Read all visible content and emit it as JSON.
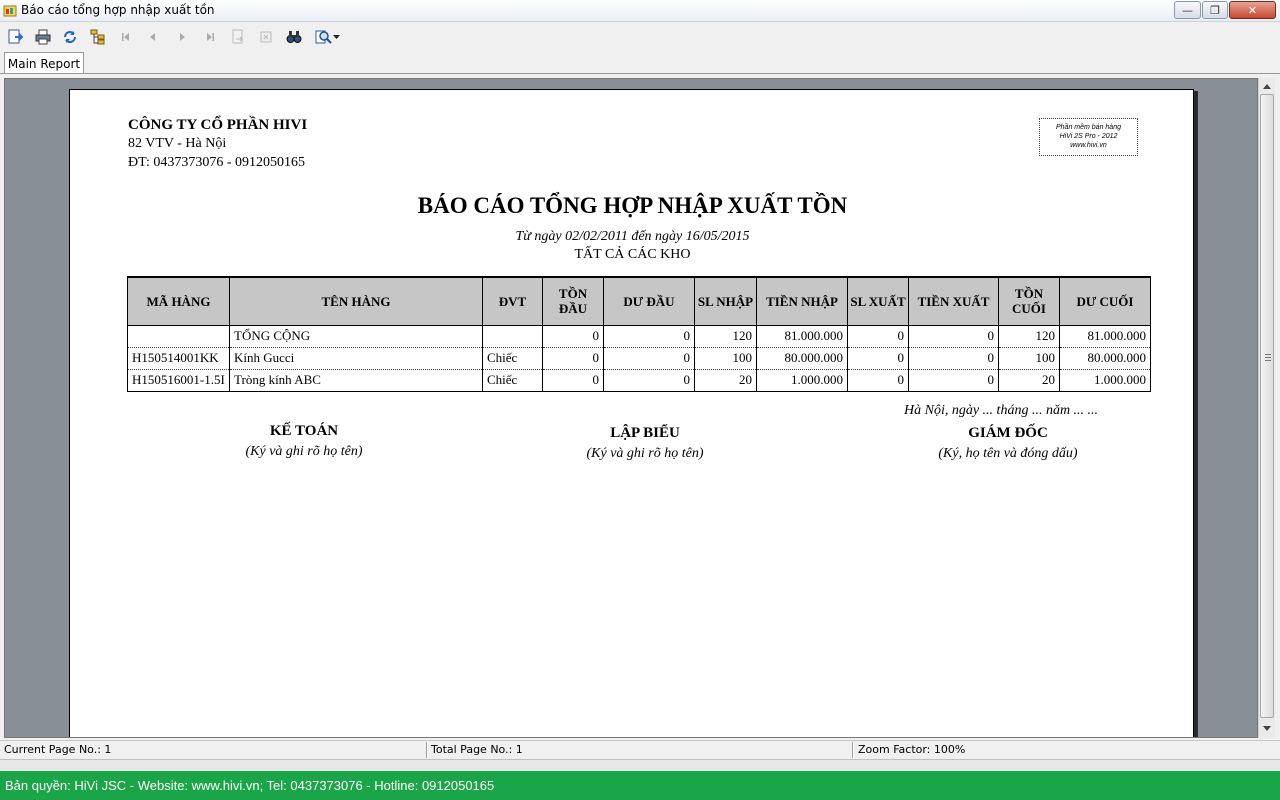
{
  "window": {
    "title": "Báo cáo tổng hợp nhập xuất tồn",
    "minimize": "—",
    "restore": "❐",
    "close": "✕"
  },
  "tab": {
    "label": "Main Report"
  },
  "report": {
    "company_name": "CÔNG TY CỔ PHẦN HIVI",
    "company_address": "82 VTV - Hà Nội",
    "company_phone": "ĐT: 0437373076 - 0912050165",
    "stamp_lines": [
      "Phần mềm bán hàng",
      "HiVi 2S Pro - 2012",
      "www.hivi.vn"
    ],
    "title": "BÁO CÁO TỔNG HỢP NHẬP XUẤT TỒN",
    "date_range": "Từ ngày 02/02/2011 đến ngày 16/05/2015",
    "warehouse": "TẤT CẢ CÁC KHO",
    "columns": [
      "MÃ HÀNG",
      "TÊN HÀNG",
      "ĐVT",
      "TỒN ĐẦU",
      "DƯ ĐẦU",
      "SL NHẬP",
      "TIỀN NHẬP",
      "SL XUẤT",
      "TIỀN XUẤT",
      "TỒN CUỐI",
      "DƯ CUỐI"
    ],
    "rows": [
      [
        "",
        "TỔNG CỘNG",
        "",
        "0",
        "0",
        "120",
        "81.000.000",
        "0",
        "0",
        "120",
        "81.000.000"
      ],
      [
        "H150514001KK",
        "Kính Gucci",
        "Chiếc",
        "0",
        "0",
        "100",
        "80.000.000",
        "0",
        "0",
        "100",
        "80.000.000"
      ],
      [
        "H150516001-1.5I",
        "Tròng kính ABC",
        "Chiếc",
        "0",
        "0",
        "20",
        "1.000.000",
        "0",
        "0",
        "20",
        "1.000.000"
      ]
    ],
    "signatures": {
      "accountant_role": "KẾ TOÁN",
      "accountant_note": "(Ký và ghi rõ họ tên)",
      "preparer_role": "LẬP BIỂU",
      "preparer_note": "(Ký và ghi rõ họ tên)",
      "place_date": "Hà Nội, ngày ... tháng ... năm ... ...",
      "director_role": "GIÁM ĐỐC",
      "director_note": "(Ký, họ tên và đóng dấu)"
    }
  },
  "status": {
    "current_page": "Current Page No.: 1",
    "total_page": "Total Page No.: 1",
    "zoom": "Zoom Factor: 100%"
  },
  "footer": {
    "text": "Bản quyền: HiVi JSC - Website: www.hivi.vn; Tel: 0437373076 - Hotline: 0912050165"
  },
  "colors": {
    "footer_bg": "#1aa548",
    "preview_bg": "#888f97",
    "table_header_bg": "#c6c6c6"
  },
  "icons": {
    "toolbar": [
      "export-icon",
      "print-icon",
      "refresh-icon",
      "group-tree-icon",
      "first-page-icon",
      "prev-page-icon",
      "next-page-icon",
      "last-page-icon",
      "goto-page-icon",
      "stop-icon",
      "find-icon",
      "zoom-icon"
    ]
  }
}
